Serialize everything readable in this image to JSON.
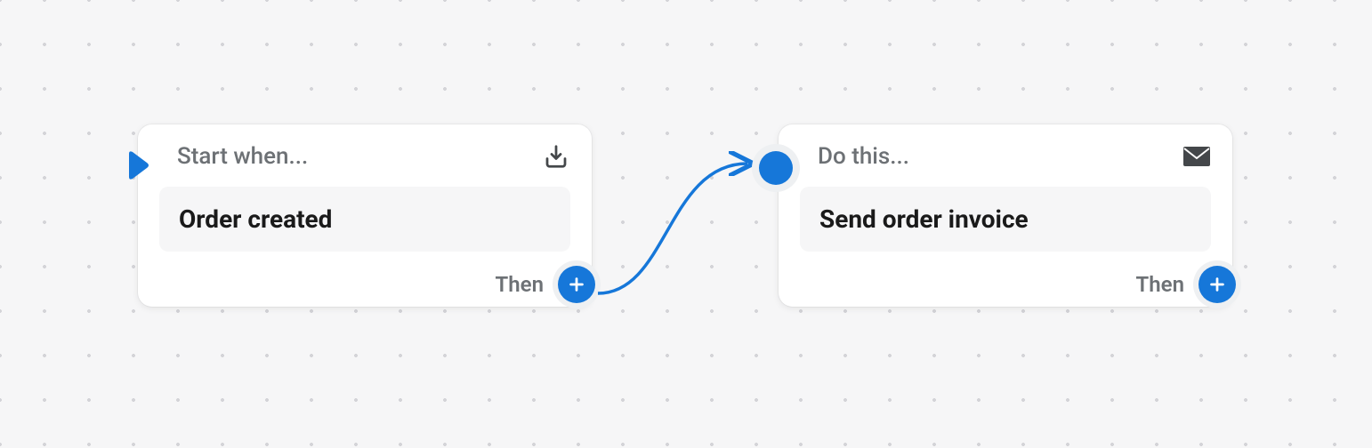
{
  "nodes": {
    "trigger": {
      "header": "Start when...",
      "content": "Order created",
      "footer_label": "Then"
    },
    "action": {
      "header": "Do this...",
      "content": "Send order invoice",
      "footer_label": "Then"
    }
  },
  "colors": {
    "accent": "#1677d9"
  }
}
